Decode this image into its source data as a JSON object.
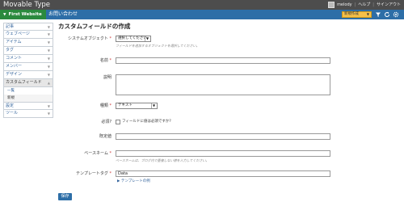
{
  "app": {
    "title": "Movable Type"
  },
  "user": {
    "name": "melody",
    "help": "ヘルプ",
    "signout": "サインアウト"
  },
  "scope": {
    "site": "First Website",
    "blog": "お問い合わせ"
  },
  "toolbar": {
    "new_label": "新規作成"
  },
  "sidebar": {
    "items": [
      {
        "label": "記事"
      },
      {
        "label": "ウェブページ"
      },
      {
        "label": "アイテム"
      },
      {
        "label": "タグ"
      },
      {
        "label": "コメント"
      },
      {
        "label": "メンバー"
      },
      {
        "label": "デザイン"
      },
      {
        "label": "カスタムフィールド"
      }
    ],
    "sub_items": [
      {
        "label": "一覧"
      },
      {
        "label": "新規"
      }
    ],
    "after_items": [
      {
        "label": "設定"
      },
      {
        "label": "ツール"
      }
    ]
  },
  "page": {
    "title": "カスタムフィールドの作成"
  },
  "form": {
    "system_object": {
      "label": "システムオブジェクト",
      "required": "*",
      "value": "選択してください",
      "hint": "フィールドを追加するオブジェクトを選択してください。"
    },
    "name": {
      "label": "名前",
      "required": "*",
      "value": ""
    },
    "description": {
      "label": "説明",
      "value": ""
    },
    "type": {
      "label": "種類",
      "required": "*",
      "value": "テキスト"
    },
    "required_field": {
      "label": "必須?",
      "checkbox_label": "フィールドに値は必須ですか?"
    },
    "default_value": {
      "label": "既定値",
      "value": ""
    },
    "basename": {
      "label": "ベースネーム",
      "required": "*",
      "value": "",
      "hint": "ベースネームは、ブログ内で重複しない値を入力してください。"
    },
    "template_tag": {
      "label": "テンプレートタグ",
      "required": "*",
      "value": "Data",
      "link": "テンプレートの例"
    },
    "save_label": "保存"
  }
}
